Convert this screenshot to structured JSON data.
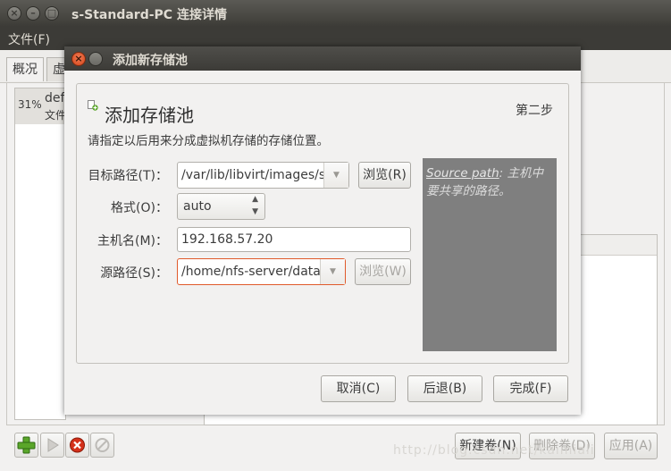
{
  "window": {
    "title": "s-Standard-PC 连接详情",
    "menu": [
      "文件(F)"
    ],
    "tabs": [
      "概况",
      "虚"
    ]
  },
  "pool_list": {
    "items": [
      {
        "percent": "31%",
        "name": "def",
        "sub": "文件"
      }
    ]
  },
  "toolbar": {
    "new_volume": "新建卷(N)",
    "delete_volume": "删除卷(D)",
    "apply": "应用(A)"
  },
  "watermark": "http://blog.csdn.net/kaimiali",
  "dialog": {
    "title": "添加新存储池",
    "heading": "添加存储池",
    "step": "第二步",
    "description": "请指定以后用来分成虚拟机存储的存储位置。",
    "target_path": {
      "label": "目标路径(T)：",
      "value": "/var/lib/libvirt/images/s",
      "browse": "浏览(R)"
    },
    "format": {
      "label": "格式(O)：",
      "value": "auto"
    },
    "host": {
      "label": "主机名(M)：",
      "value": "192.168.57.20"
    },
    "source_path": {
      "label": "源路径(S)：",
      "value": "/home/nfs-server/data",
      "browse": "浏览(W)"
    },
    "help": {
      "term": "Source path",
      "text": ": 主机中要共享的路径。"
    },
    "buttons": {
      "cancel": "取消(C)",
      "back": "后退(B)",
      "finish": "完成(F)"
    }
  }
}
